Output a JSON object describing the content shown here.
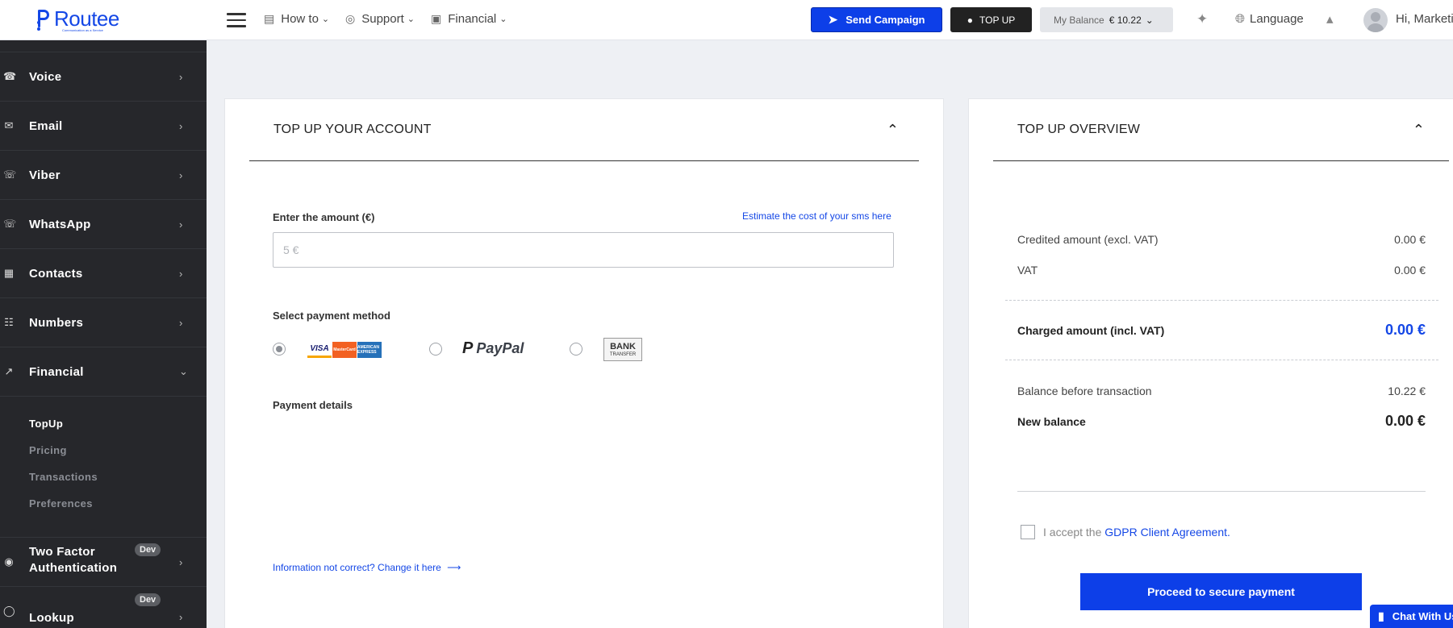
{
  "header": {
    "logo": "Routee",
    "tagline": "Communication as a Service",
    "nav": [
      {
        "label": "How to",
        "icon": "book-icon"
      },
      {
        "label": "Support",
        "icon": "lifebuoy-icon"
      },
      {
        "label": "Financial",
        "icon": "document-icon"
      }
    ],
    "send_campaign": "Send Campaign",
    "topup": "TOP UP",
    "balance_label": "My Balance",
    "balance_value": "€ 10.22",
    "language": "Language",
    "greeting": "Hi, Marketing"
  },
  "sidebar": {
    "items": [
      {
        "label": "Voice",
        "icon": "voice-icon"
      },
      {
        "label": "Email",
        "icon": "email-icon"
      },
      {
        "label": "Viber",
        "icon": "viber-icon"
      },
      {
        "label": "WhatsApp",
        "icon": "whatsapp-icon"
      },
      {
        "label": "Contacts",
        "icon": "contacts-icon"
      },
      {
        "label": "Numbers",
        "icon": "numbers-icon"
      },
      {
        "label": "Financial",
        "icon": "chart-icon"
      }
    ],
    "financial_sub": [
      "TopUp",
      "Pricing",
      "Transactions",
      "Preferences"
    ],
    "two_factor": "Two Factor Authentication",
    "two_factor_l1": "Two Factor",
    "two_factor_l2": "Authentication",
    "lookup": "Lookup",
    "dev_badge": "Dev"
  },
  "topup_card": {
    "title": "TOP UP YOUR ACCOUNT",
    "amount_label": "Enter the amount (€)",
    "estimate_link": "Estimate the cost of your sms here",
    "amount_placeholder": "5 €",
    "amount_value": "",
    "payment_method_label": "Select payment method",
    "methods": [
      "VISA / MasterCard / American Express",
      "PayPal",
      "Bank Transfer"
    ],
    "selected_method": "VISA / MasterCard / American Express",
    "visa_text": "VISA",
    "mastercard_text": "MasterCard",
    "amex_text": "AMERICAN EXPRESS",
    "paypal_text": "PayPal",
    "bank_text": "BANK",
    "bank_sub": "TRANSFER",
    "payment_details_label": "Payment details",
    "info_link": "Information not correct? Change it here"
  },
  "overview_card": {
    "title": "TOP UP OVERVIEW",
    "credited_label": "Credited amount (excl. VAT)",
    "credited_value": "0.00 €",
    "vat_label": "VAT",
    "vat_value": "0.00 €",
    "charged_label": "Charged amount (incl. VAT)",
    "charged_value": "0.00 €",
    "before_label": "Balance before transaction",
    "before_value": "10.22 €",
    "new_label": "New balance",
    "new_value": "0.00 €",
    "accept_prefix": "I accept the",
    "accept_link": "GDPR Client Agreement.",
    "proceed": "Proceed to secure payment"
  },
  "chat": {
    "label": "Chat With Us"
  },
  "colors": {
    "brand_blue": "#0d3fe8",
    "sidebar_bg": "#26272b",
    "page_bg": "#eef0f4"
  }
}
